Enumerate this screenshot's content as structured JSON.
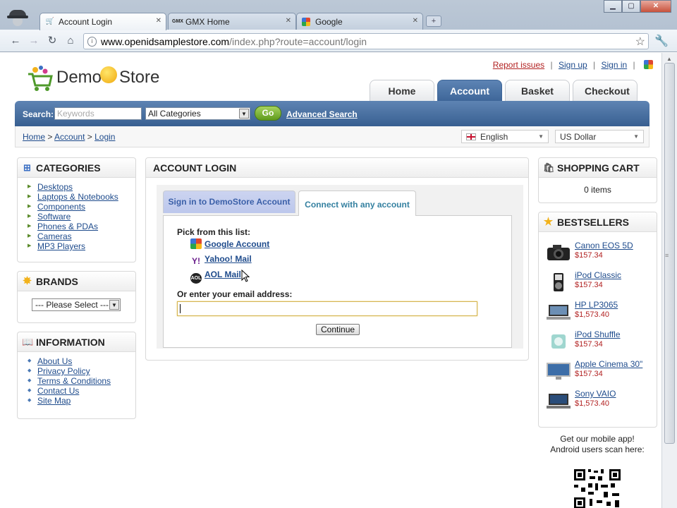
{
  "browser": {
    "tabs": [
      {
        "label": "Account Login",
        "icon": "cart-icon",
        "active": true
      },
      {
        "label": "GMX Home",
        "icon": "gmx-icon",
        "prefix": "GMX",
        "active": false
      },
      {
        "label": "Google",
        "icon": "google-icon",
        "active": false
      }
    ],
    "url_host": "www.openidsamplestore.com",
    "url_path": "/index.php?route=account/login"
  },
  "header": {
    "logo_word1": "Demo",
    "logo_word2": "Store",
    "links": {
      "report": "Report issues",
      "signup": "Sign up",
      "signin": "Sign in",
      "sep": "|"
    },
    "nav": [
      "Home",
      "Account",
      "Basket",
      "Checkout"
    ],
    "nav_active": "Account"
  },
  "search": {
    "label": "Search:",
    "placeholder": "Keywords",
    "category": "All Categories",
    "go": "Go",
    "advanced": "Advanced Search"
  },
  "breadcrumb": {
    "home": "Home",
    "sep": ">",
    "account": "Account",
    "login": "Login"
  },
  "locale": {
    "language": "English",
    "currency": "US Dollar"
  },
  "categories": {
    "title": "CATEGORIES",
    "items": [
      "Desktops",
      "Laptops & Notebooks",
      "Components",
      "Software",
      "Phones & PDAs",
      "Cameras",
      "MP3 Players"
    ]
  },
  "brands": {
    "title": "BRANDS",
    "select": "--- Please Select ---"
  },
  "information": {
    "title": "INFORMATION",
    "items": [
      "About Us",
      "Privacy Policy",
      "Terms & Conditions",
      "Contact Us",
      "Site Map"
    ]
  },
  "login": {
    "title": "ACCOUNT LOGIN",
    "tab1": "Sign in to DemoStore Account",
    "tab2": "Connect with any account",
    "pick": "Pick from this list:",
    "providers": [
      {
        "name": "Google Account",
        "icon": "google-icon"
      },
      {
        "name": "Yahoo! Mail",
        "icon": "yahoo-icon",
        "glyph": "Y!"
      },
      {
        "name": "AOL Mail",
        "icon": "aol-icon",
        "glyph": "AOL"
      }
    ],
    "email_label": "Or enter your email address:",
    "email_value": "",
    "continue": "Continue"
  },
  "cart": {
    "title": "SHOPPING CART",
    "count": "0 items"
  },
  "bestsellers": {
    "title": "BESTSELLERS",
    "items": [
      {
        "name": "Canon EOS 5D",
        "price": "$157.34",
        "icon": "camera-icon"
      },
      {
        "name": "iPod Classic",
        "price": "$157.34",
        "icon": "ipod-icon"
      },
      {
        "name": "HP LP3065",
        "price": "$1,573.40",
        "icon": "laptop-icon"
      },
      {
        "name": "iPod Shuffle",
        "price": "$157.34",
        "icon": "shuffle-icon"
      },
      {
        "name": "Apple Cinema 30\"",
        "price": "$157.34",
        "icon": "monitor-icon"
      },
      {
        "name": "Sony VAIO",
        "price": "$1,573.40",
        "icon": "laptop-icon"
      }
    ]
  },
  "mobile": {
    "line1": "Get our mobile app!",
    "line2": "Android users scan here:"
  },
  "colors": {
    "nav_blue": "#3e6699",
    "link": "#1e4b8c",
    "price": "#b22222",
    "go_green": "#5f9a1d"
  }
}
